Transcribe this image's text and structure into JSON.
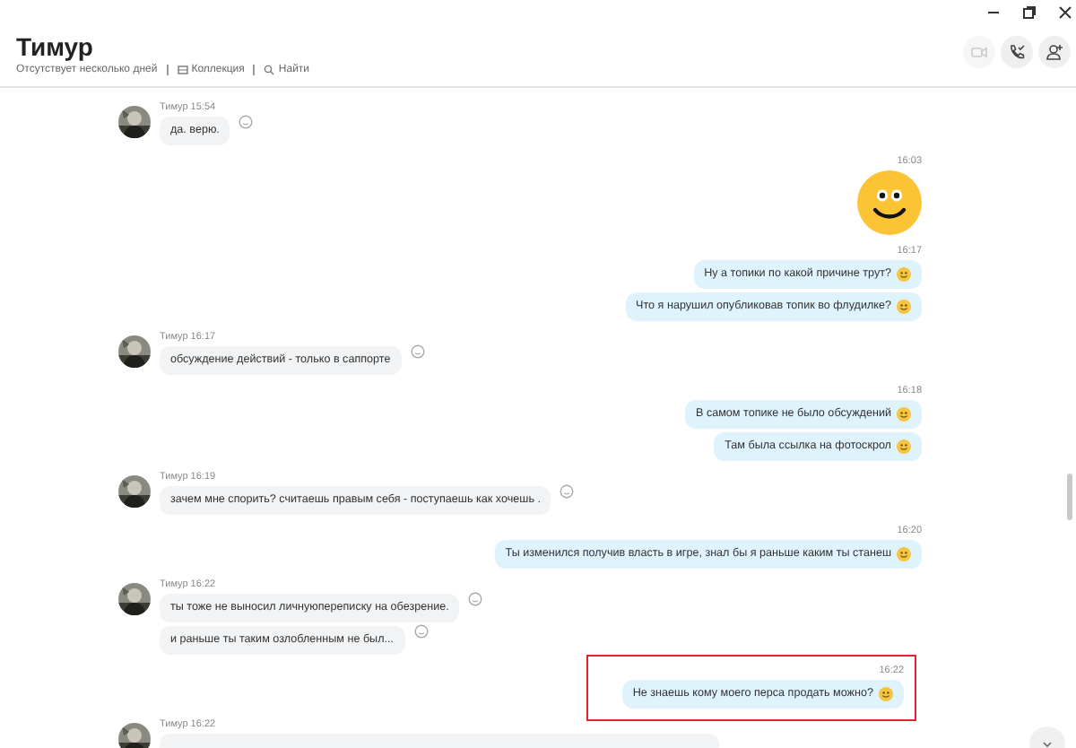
{
  "header": {
    "title": "Тимур",
    "status": "Отсутствует несколько дней",
    "links": [
      {
        "kind": "collection",
        "label": "Коллекция"
      },
      {
        "kind": "search",
        "label": "Найти"
      }
    ],
    "actions": [
      {
        "kind": "video",
        "disabled": true
      },
      {
        "kind": "call",
        "disabled": false
      },
      {
        "kind": "add-contact",
        "disabled": false
      }
    ]
  },
  "feed": [
    {
      "kind": "incoming",
      "sender": "Тимур",
      "time": "15:54",
      "messages": [
        "да. верю."
      ]
    },
    {
      "kind": "sticker",
      "time": "16:03"
    },
    {
      "kind": "outgoing",
      "time": "16:17",
      "highlighted": false,
      "messages": [
        "Ну а топики по какой причине трут?",
        "Что я нарушил опубликовав топик во флудилке?"
      ]
    },
    {
      "kind": "incoming",
      "sender": "Тимур",
      "time": "16:17",
      "messages": [
        "обсуждение действий - только в саппорте"
      ]
    },
    {
      "kind": "outgoing",
      "time": "16:18",
      "highlighted": false,
      "messages": [
        "В самом топике не было обсуждений",
        "Там была ссылка на фотоскрол"
      ]
    },
    {
      "kind": "incoming",
      "sender": "Тимур",
      "time": "16:19",
      "messages": [
        "зачем мне спорить? считаешь правым себя - поступаешь как хочешь ."
      ]
    },
    {
      "kind": "outgoing",
      "time": "16:20",
      "highlighted": false,
      "messages": [
        "Ты изменился получив власть в игре, знал бы я раньше каким ты станеш"
      ]
    },
    {
      "kind": "incoming",
      "sender": "Тимур",
      "time": "16:22",
      "messages": [
        "ты тоже не выносил личнуюпереписку на обезрение.",
        "и раньше ты таким озлобленным не был..."
      ]
    },
    {
      "kind": "outgoing",
      "time": "16:22",
      "highlighted": true,
      "messages": [
        "Не знаешь кому моего перса продать можно?"
      ]
    },
    {
      "kind": "incoming",
      "sender": "Тимур",
      "time": "16:22"
    }
  ]
}
